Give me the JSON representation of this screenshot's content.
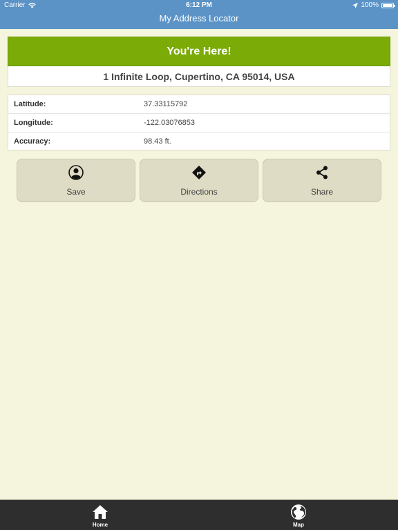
{
  "status_bar": {
    "carrier": "Carrier",
    "time": "6:12 PM",
    "battery": "100%"
  },
  "nav": {
    "title": "My Address Locator"
  },
  "location": {
    "heading": "You're Here!",
    "address": "1 Infinite Loop, Cupertino, CA 95014, USA"
  },
  "info": {
    "rows": [
      {
        "label": "Latitude:",
        "value": "37.33115792"
      },
      {
        "label": "Longitude:",
        "value": "-122.03076853"
      },
      {
        "label": "Accuracy:",
        "value": "98.43 ft."
      }
    ]
  },
  "actions": {
    "save_label": "Save",
    "directions_label": "Directions",
    "share_label": "Share"
  },
  "tabs": {
    "home_label": "Home",
    "map_label": "Map"
  },
  "colors": {
    "nav_bar": "#5b93c7",
    "accent_green": "#7aab07",
    "background": "#f5f4dc",
    "tab_bar": "#2e2e2e"
  }
}
